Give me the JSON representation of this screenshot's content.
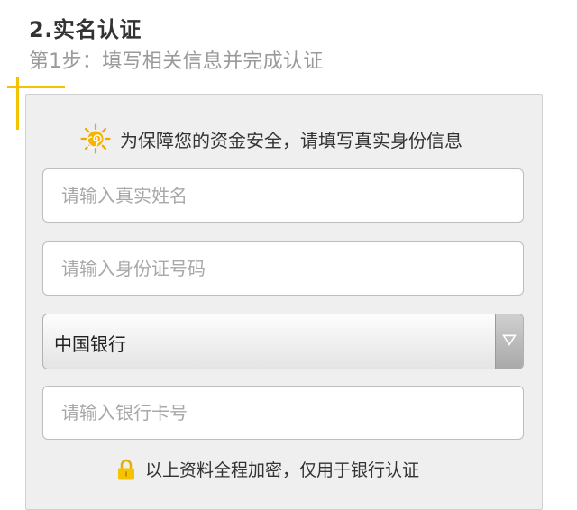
{
  "section": {
    "title": "2.实名认证",
    "subtitle": "第1步：填写相关信息并完成认证"
  },
  "card": {
    "notice": "为保障您的资金安全，请填写真实身份信息",
    "notice_icon": "sun-icon",
    "name_placeholder": "请输入真实姓名",
    "id_placeholder": "请输入身份证号码",
    "bank_select_value": "中国银行",
    "card_placeholder": "请输入银行卡号",
    "footer_note": "以上资料全程加密，仅用于银行认证",
    "footer_icon": "lock-icon"
  },
  "colors": {
    "accent": "#f5c400",
    "card_bg": "#efefef",
    "placeholder": "#a8a8a8"
  }
}
